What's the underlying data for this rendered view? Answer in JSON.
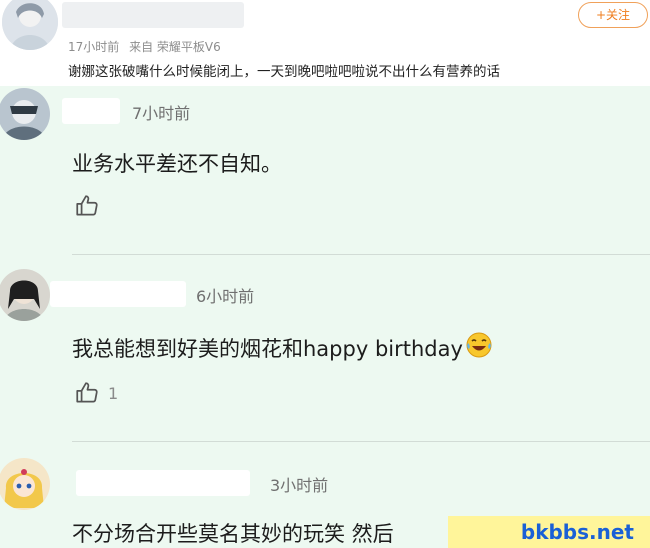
{
  "post": {
    "follow_label": "+关注",
    "time": "17小时前",
    "source": "来自 荣耀平板V6",
    "content": "谢娜这张破嘴什么时候能闭上，一天到晚吧啦吧啦说不出什么有营养的话"
  },
  "comments": [
    {
      "time": "7小时前",
      "text": "业务水平差还不自知。",
      "likes": ""
    },
    {
      "time": "6小时前",
      "text": "我总能想到好美的烟花和happy birthday",
      "likes": "1"
    },
    {
      "time": "3小时前",
      "text": "不分场合开些莫名其妙的玩笑 然后",
      "likes": ""
    }
  ],
  "watermark": "bkbbs.net",
  "colors": {
    "follow_accent": "#ef7d1c",
    "comment_bg": "#edf9f1",
    "watermark_bg": "#fff59a",
    "watermark_text": "#1a60d6"
  },
  "icons": {
    "like": "thumbs-up-icon",
    "emoji": "laughing-tears-emoji-icon"
  }
}
